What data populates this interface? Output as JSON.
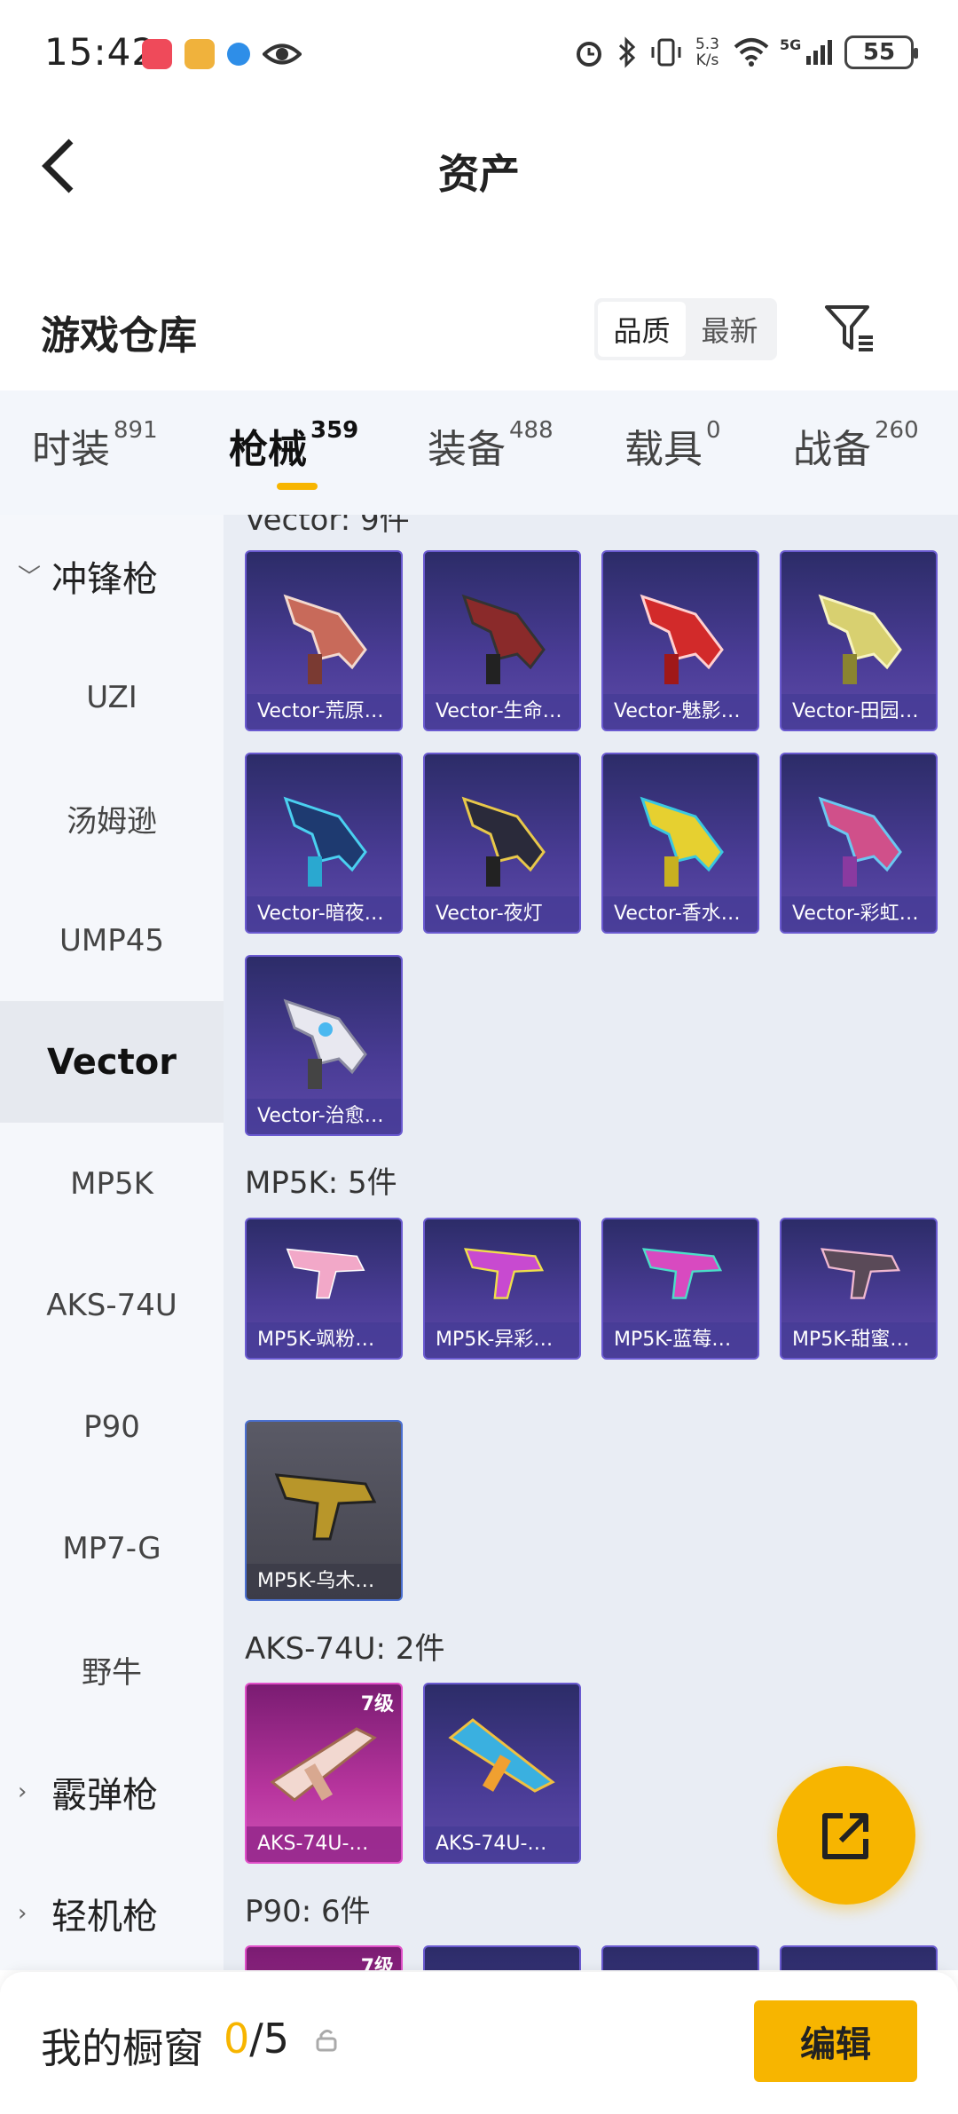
{
  "status": {
    "time": "15:42",
    "net_speed_top": "5.3",
    "net_speed_bottom": "K/s",
    "net_type": "5G",
    "battery": "55",
    "colors": {
      "app1": "#ef4a5a",
      "app2": "#f0b23c",
      "app3": "#2e8ee8"
    }
  },
  "header": {
    "title": "资产"
  },
  "warehouse": {
    "title": "游戏仓库",
    "sort": [
      "品质",
      "最新"
    ],
    "sort_active": 0
  },
  "tabs": [
    {
      "label": "时装",
      "count": "891"
    },
    {
      "label": "枪械",
      "count": "359"
    },
    {
      "label": "装备",
      "count": "488"
    },
    {
      "label": "载具",
      "count": "0"
    },
    {
      "label": "战备",
      "count": "260"
    }
  ],
  "sidebar": {
    "groups": [
      "冲锋枪",
      "霰弹枪",
      "轻机枪"
    ],
    "items": [
      "UZI",
      "汤姆逊",
      "UMP45",
      "Vector",
      "MP5K",
      "AKS-74U",
      "P90",
      "MP7-G",
      "野牛"
    ]
  },
  "sections": [
    {
      "title": "Vector: 9件",
      "cards": [
        "Vector-荒原…",
        "Vector-生命…",
        "Vector-魅影…",
        "Vector-田园…",
        "Vector-暗夜…",
        "Vector-夜灯",
        "Vector-香水…",
        "Vector-彩虹…",
        "Vector-治愈…"
      ]
    },
    {
      "title": "MP5K: 5件",
      "cards": [
        "MP5K-飒粉…",
        "MP5K-异彩…",
        "MP5K-蓝莓…",
        "MP5K-甜蜜…",
        "MP5K-乌木…"
      ]
    },
    {
      "title": "AKS-74U: 2件",
      "cards": [
        "AKS-74U-…",
        "AKS-74U-…"
      ],
      "level": "7级"
    },
    {
      "title": "P90: 6件",
      "level": "7级"
    }
  ],
  "bottom": {
    "title": "我的橱窗",
    "current": "0",
    "total": "/5",
    "edit": "编辑"
  },
  "accent": "#f7b500"
}
